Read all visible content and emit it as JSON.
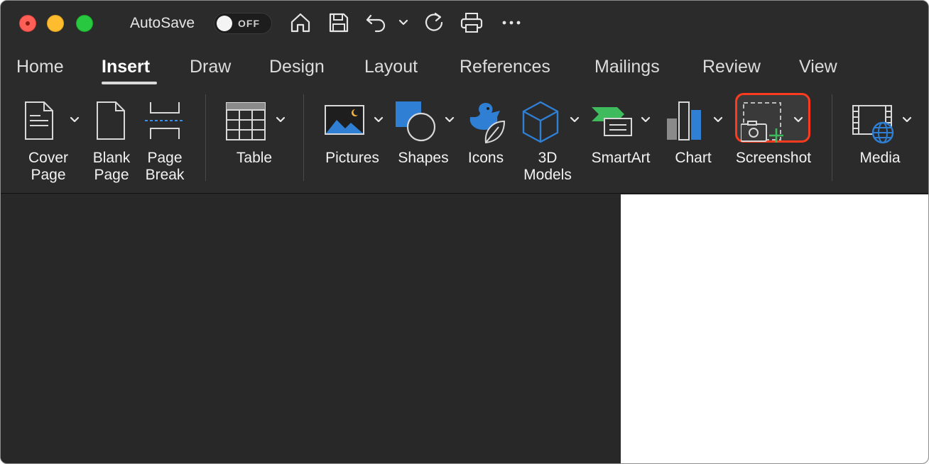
{
  "titlebar": {
    "window_controls": [
      "close",
      "minimize",
      "zoom"
    ],
    "autosave_label": "AutoSave",
    "autosave_state": "OFF",
    "quick_access_icons": [
      "home-icon",
      "save-icon",
      "undo-icon",
      "chevron-down-icon",
      "redo-icon",
      "print-icon",
      "more-icon"
    ]
  },
  "tabs": {
    "items": [
      {
        "label": "Home"
      },
      {
        "label": "Insert"
      },
      {
        "label": "Draw"
      },
      {
        "label": "Design"
      },
      {
        "label": "Layout"
      },
      {
        "label": "References"
      },
      {
        "label": "Mailings"
      },
      {
        "label": "Review"
      },
      {
        "label": "View"
      }
    ],
    "active": "Insert"
  },
  "ribbon": {
    "cover_page": {
      "line1": "Cover",
      "line2": "Page"
    },
    "blank_page": {
      "line1": "Blank",
      "line2": "Page"
    },
    "page_break": {
      "line1": "Page",
      "line2": "Break"
    },
    "table": {
      "label": "Table"
    },
    "pictures": {
      "label": "Pictures"
    },
    "shapes": {
      "label": "Shapes"
    },
    "icons": {
      "label": "Icons"
    },
    "models_3d": {
      "line1": "3D",
      "line2": "Models"
    },
    "smartart": {
      "label": "SmartArt"
    },
    "chart": {
      "label": "Chart"
    },
    "screenshot": {
      "label": "Screenshot",
      "highlighted": true
    },
    "media": {
      "label": "Media"
    }
  },
  "colors": {
    "highlight_border": "#ff3b1f",
    "accent_blue": "#2f7fd4",
    "accent_green": "#3dbb5d"
  }
}
